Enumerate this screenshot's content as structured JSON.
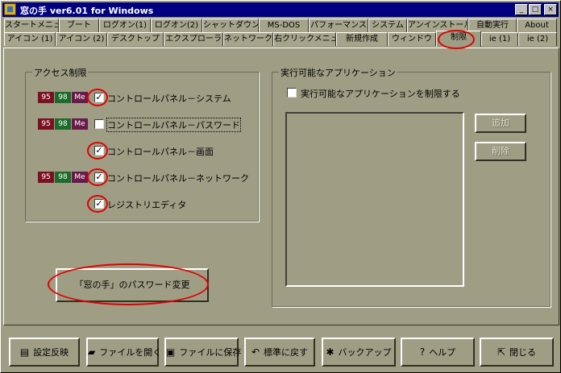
{
  "window": {
    "title": "窓の手 ver6.01 for Windows",
    "controls": {
      "minimize": "_",
      "maximize": "□",
      "close": "×"
    }
  },
  "tabs_row1": [
    "スタートメニュー",
    "ブート",
    "ログオン(1)",
    "ログオン(2)",
    "シャットダウン",
    "MS-DOS",
    "パフォーマンス",
    "システム",
    "アンインストール",
    "自動実行",
    "About"
  ],
  "tabs_row2": [
    "アイコン (1)",
    "アイコン (2)",
    "デスクトップ",
    "エクスプローラ",
    "ネットワーク",
    "右クリックメニュー",
    "新規作成",
    "ウィンドウ",
    "制限",
    "ie (1)",
    "ie (2)"
  ],
  "active_tab": "制限",
  "access": {
    "title": "アクセス制限",
    "badges": [
      "95",
      "98",
      "Me"
    ],
    "items": [
      {
        "label": "コントロールパネル－システム",
        "checked": true,
        "check_mark": "✓"
      },
      {
        "label": "コントロールパネル－パスワード",
        "checked": false,
        "check_mark": ""
      },
      {
        "label": "コントロールパネル－画面",
        "checked": true,
        "check_mark": "✓"
      },
      {
        "label": "コントロールパネル－ネットワーク",
        "checked": true,
        "check_mark": "✓"
      },
      {
        "label": "レジストリエディタ",
        "checked": true,
        "check_mark": "✓"
      }
    ]
  },
  "password_button": "「窓の手」のパスワード変更",
  "apps": {
    "title": "実行可能なアプリケーション",
    "restrict_label": "実行可能なアプリケーションを制限する",
    "restrict_checked": false,
    "add_button": "追加",
    "delete_button": "削除"
  },
  "footer": {
    "apply": "設定反映",
    "open": "ファイルを開く",
    "save": "ファイルに保存",
    "reset": "標準に戻す",
    "backup": "バックアップ",
    "help": "ヘルプ",
    "close": "閉じる"
  },
  "colors": {
    "badge_95": "#7a1020",
    "badge_98": "#1d6b2a",
    "badge_me": "#6a1a4a",
    "highlight": "#e00000"
  }
}
